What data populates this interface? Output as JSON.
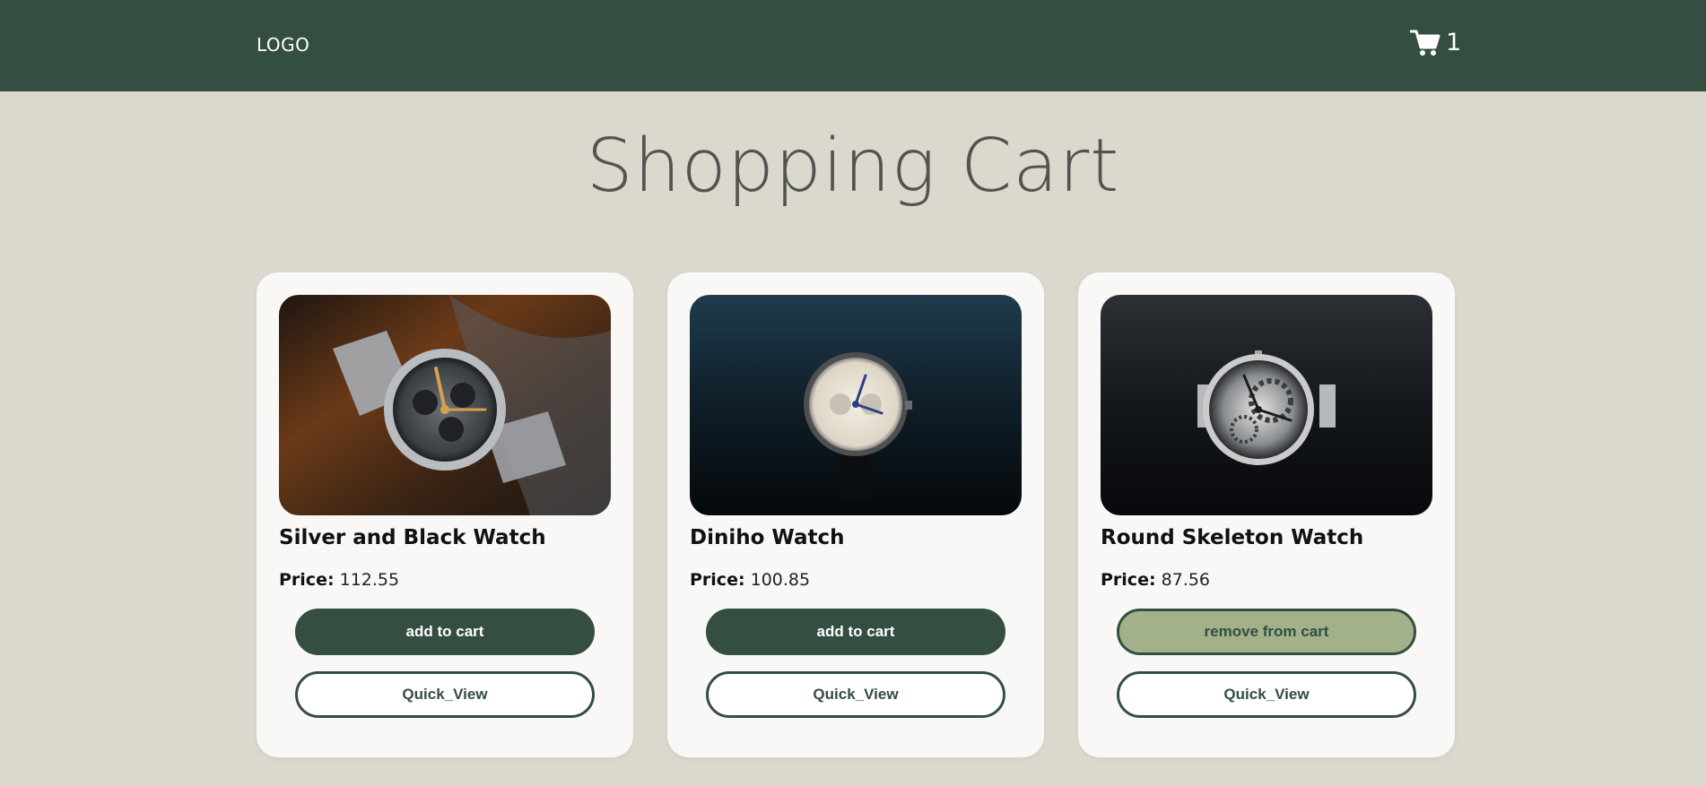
{
  "header": {
    "logo": "LOGO",
    "cart_icon": "cart-icon",
    "cart_count": "1"
  },
  "page": {
    "title": "Shopping Cart"
  },
  "products": [
    {
      "name": "Silver and Black Watch",
      "price_label": "Price:",
      "price": "112.55",
      "action_label": "add to cart",
      "quick_view_label": "Quick_View"
    },
    {
      "name": "Diniho Watch",
      "price_label": "Price:",
      "price": "100.85",
      "action_label": "add to cart",
      "quick_view_label": "Quick_View"
    },
    {
      "name": "Round Skeleton Watch",
      "price_label": "Price:",
      "price": "87.56",
      "action_label": "remove from cart",
      "quick_view_label": "Quick_View"
    }
  ],
  "colors": {
    "brand": "#344e41",
    "accent": "#a3b18a",
    "background": "#dbd9cd",
    "card": "#faf8f6"
  }
}
